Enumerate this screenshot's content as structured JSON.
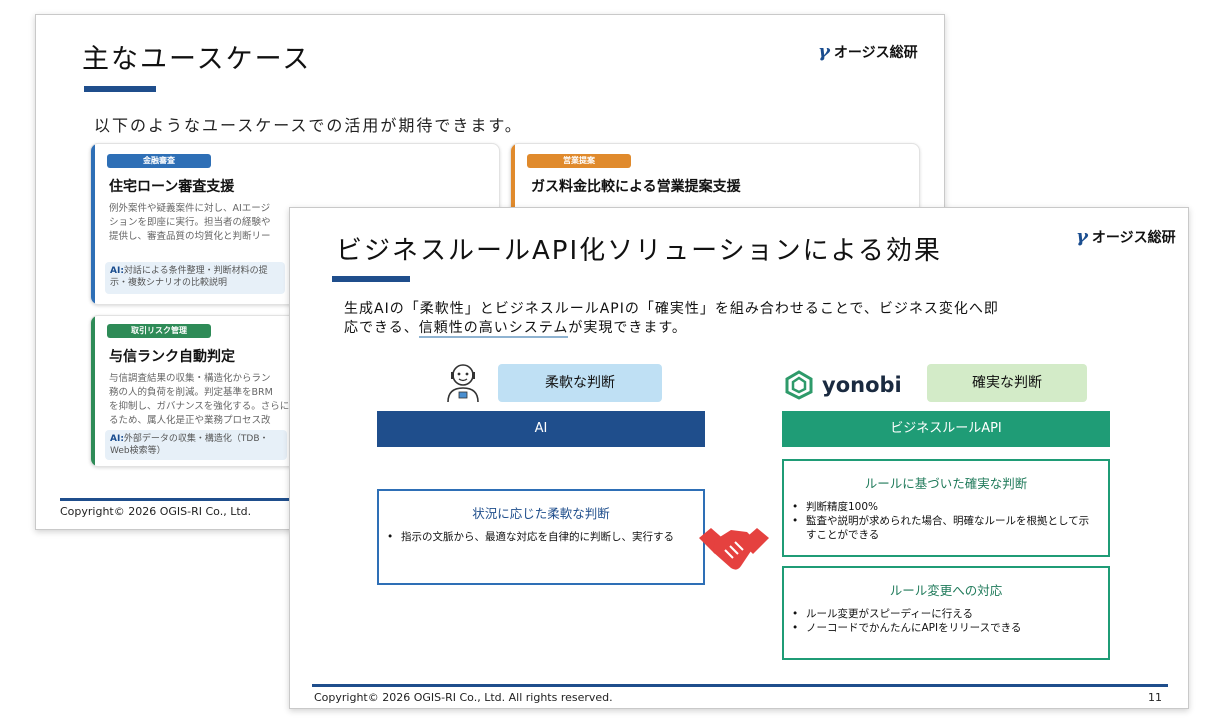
{
  "logo_text": "オージス総研",
  "slide1": {
    "title": "主なユースケース",
    "intro": "以下のようなユースケースでの活用が期待できます。",
    "cards": [
      {
        "tag": "金融審査",
        "tag_color": "#2e6fb6",
        "title": "住宅ローン審査支援",
        "body": [
          "例外案件や疑義案件に対し、AIエージ",
          "ションを即座に実行。担当者の経験や",
          "提供し、審査品質の均質化と判断リー"
        ],
        "ai_label": "AI:",
        "ai_text": "対話による条件整理・判断材料の提示・複数シナリオの比較説明"
      },
      {
        "tag": "営業提案",
        "tag_color": "#e08a2c",
        "title": "ガス料金比較による営業提案支援",
        "body": [],
        "ai_label": "",
        "ai_text": ""
      },
      {
        "tag": "取引リスク管理",
        "tag_color": "#2e8b57",
        "title": "与信ランク自動判定",
        "body": [
          "与信調査結果の収集・構造化からラン",
          "務の人的負荷を削減。判定基準をBRM",
          "を抑制し、ガバナンスを強化する。さらに",
          "るため、属人化是正や業務プロセス改"
        ],
        "ai_label": "AI:",
        "ai_text": "外部データの収集・構造化（TDB・Web検索等）"
      }
    ],
    "copyright": "Copyright© 2026 OGIS-RI Co., Ltd."
  },
  "slide2": {
    "title": "ビジネスルールAPI化ソリューションによる効果",
    "intro_line1": "生成AIの「柔軟性」とビジネスルールAPIの「確実性」を組み合わせることで、ビジネス変化へ即",
    "intro_line2_pre": "応できる、",
    "intro_line2_highlight": "信頼性の高いシステム",
    "intro_line2_post": "が実現できます。",
    "left_pill": "柔軟な判断",
    "left_header": "AI",
    "left_box_title": "状況に応じた柔軟な判断",
    "left_box_items": [
      "指示の文脈から、最適な対応を自律的に判断し、実行する"
    ],
    "brand": "yonobi",
    "right_pill": "確実な判断",
    "right_header": "ビジネスルールAPI",
    "right_box1_title": "ルールに基づいた確実な判断",
    "right_box1_items": [
      "判断精度100%",
      "監査や説明が求められた場合、明確なルールを根拠として示すことができる"
    ],
    "right_box2_title": "ルール変更への対応",
    "right_box2_items": [
      "ルール変更がスピーディーに行える",
      "ノーコードでかんたんにAPIをリリースできる"
    ],
    "copyright": "Copyright© 2026 OGIS-RI Co., Ltd.  All rights reserved.",
    "page_number": "11"
  }
}
